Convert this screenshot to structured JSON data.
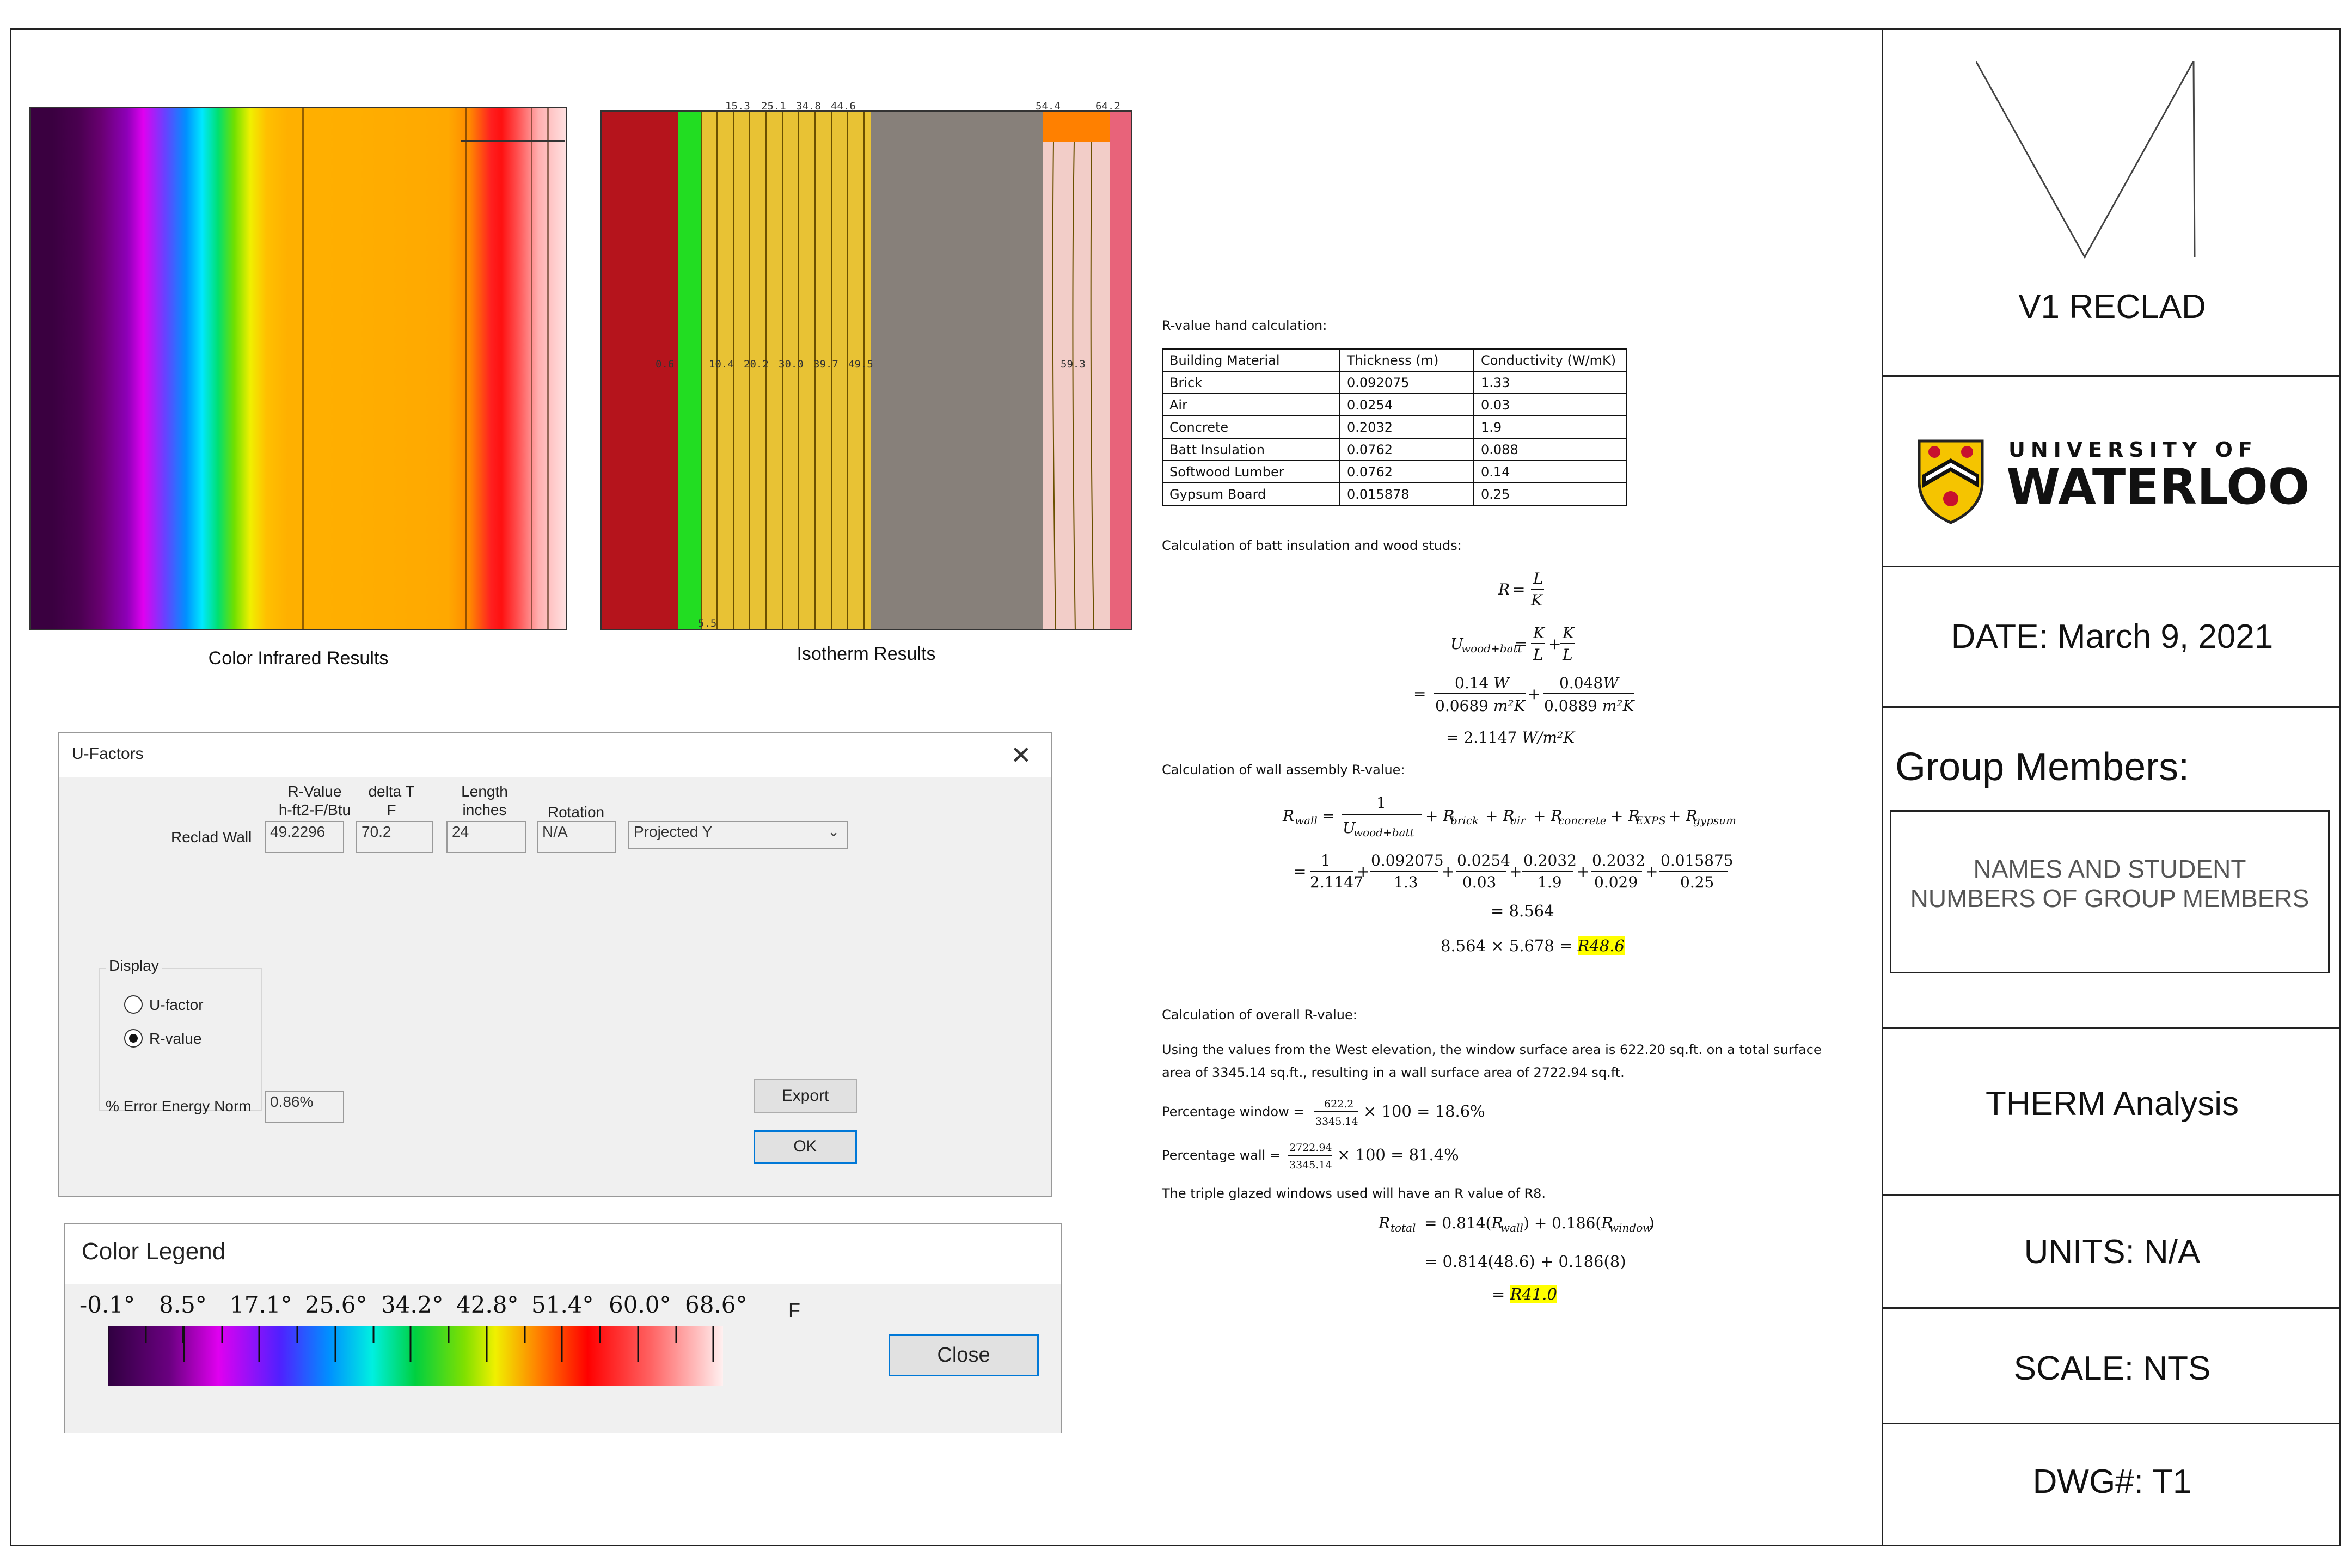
{
  "title_block": {
    "project": "V1 RECLAD",
    "university_line1": "UNIVERSITY OF",
    "university_line2": "WATERLOO",
    "date": "DATE: March 9, 2021",
    "group_members_label": "Group Members:",
    "group_members_line1": "NAMES AND STUDENT",
    "group_members_line2": "NUMBERS OF GROUP MEMBERS",
    "analysis": "THERM Analysis",
    "units": "UNITS: N/A",
    "scale": "SCALE: NTS",
    "drawing_number": "DWG#: T1"
  },
  "captions": {
    "infrared": "Color Infrared Results",
    "isotherm": "Isotherm Results"
  },
  "isotherm_labels": {
    "top": [
      "15.3",
      "25.1",
      "34.8",
      "44.6",
      "54.4",
      "64.2"
    ],
    "middle": [
      "0.6",
      "10.4",
      "20.2",
      "30.0",
      "39.7",
      "49.5",
      "59.3"
    ],
    "bottom": "5.5"
  },
  "ufactors": {
    "title": "U-Factors",
    "col_rvalue_line1": "R-Value",
    "col_rvalue_line2": "h-ft2-F/Btu",
    "col_deltat_line1": "delta T",
    "col_deltat_line2": "F",
    "col_length_line1": "Length",
    "col_length_line2": "inches",
    "col_rotation": "Rotation",
    "row_label": "Reclad Wall",
    "rvalue": "49.2296",
    "delta_t": "70.2",
    "length": "24",
    "rotation": "N/A",
    "projection": "Projected Y",
    "display_label": "Display",
    "radio_ufactor": "U-factor",
    "radio_rvalue": "R-value",
    "error_label": "% Error Energy Norm",
    "error_value": "0.86%",
    "export_button": "Export",
    "ok_button": "OK"
  },
  "legend": {
    "title": "Color Legend",
    "ticks": [
      "-0.1°",
      "8.5°",
      "17.1°",
      "25.6°",
      "34.2°",
      "42.8°",
      "51.4°",
      "60.0°",
      "68.6°"
    ],
    "unit": "F",
    "close_button": "Close"
  },
  "calc": {
    "hand_calc_heading": "R-value hand calculation:",
    "table_headers": [
      "Building Material",
      "Thickness (m)",
      "Conductivity (W/mK)"
    ],
    "table_rows": [
      [
        "Brick",
        "0.092075",
        "1.33"
      ],
      [
        "Air",
        "0.0254",
        "0.03"
      ],
      [
        "Concrete",
        "0.2032",
        "1.9"
      ],
      [
        "Batt Insulation",
        "0.0762",
        "0.088"
      ],
      [
        "Softwood Lumber",
        "0.0762",
        "0.14"
      ],
      [
        "Gypsum Board",
        "0.015878",
        "0.25"
      ]
    ],
    "batt_heading": "Calculation of batt insulation and wood studs:",
    "wall_heading": "Calculation of wall assembly R-value:",
    "wall_result": "= 8.564",
    "wall_conversion": "8.564  × 5.678 = ",
    "wall_r": "R48.6",
    "overall_heading": "Calculation of overall R-value:",
    "overall_para_line1": "Using the values from the West elevation, the window surface area is 622.20 sq.ft. on a total surface",
    "overall_para_line2": "area of 3345.14 sq.ft., resulting in a wall surface area of 2722.94 sq.ft.",
    "pct_window_label": "Percentage window =",
    "pct_window_result": "× 100 =  18.6%",
    "pct_wall_label": "Percentage wall =",
    "pct_wall_result": "× 100 = 81.4%",
    "triple_glazed": "The triple glazed windows used will have an R value of R8.",
    "total_line2": "= 0.814(48.6) + 0.186(8)",
    "total_r": "R41.0"
  },
  "colors": {
    "brick": "#b5141c",
    "air": "#22dd22",
    "insulation": "#e8c234",
    "concrete": "#87807a",
    "gypsum": "#f2cdc8",
    "highlight": "#ffff00"
  }
}
